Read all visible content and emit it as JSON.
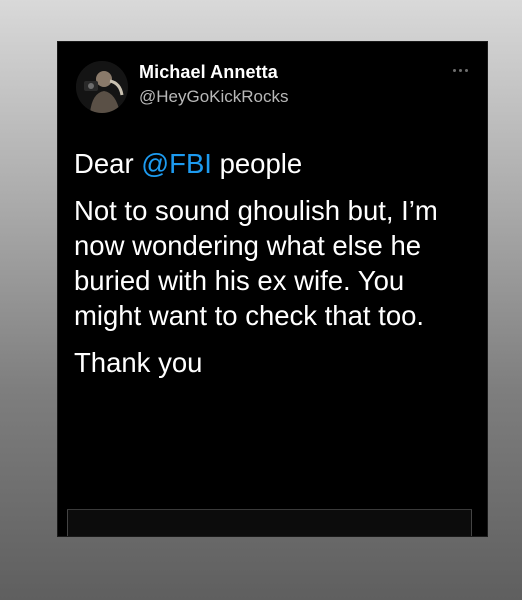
{
  "tweet": {
    "author_name": "Michael Annetta",
    "author_handle": "@HeyGoKickRocks",
    "line1_prefix": "Dear ",
    "line1_mention": "@FBI",
    "line1_suffix": " people",
    "paragraph2": "Not to sound ghoulish but, I’m now wondering what else he buried with his ex wife. You might want to check that too.",
    "paragraph3": "Thank you",
    "more_icon": "more-horizontal-icon"
  },
  "colors": {
    "card_bg": "#000000",
    "text": "#ffffff",
    "handle": "#b8b8b8",
    "mention": "#1d9bf0"
  }
}
